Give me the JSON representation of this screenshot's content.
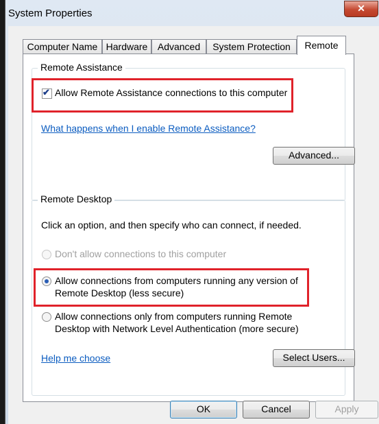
{
  "window": {
    "title": "System Properties",
    "close_glyph": "✕"
  },
  "tabs": [
    {
      "label": "Computer Name"
    },
    {
      "label": "Hardware"
    },
    {
      "label": "Advanced"
    },
    {
      "label": "System Protection"
    },
    {
      "label": "Remote"
    }
  ],
  "active_tab": "Remote",
  "remote_assistance": {
    "group_title": "Remote Assistance",
    "allow_label": "Allow Remote Assistance connections to this computer",
    "allow_checked": true,
    "help_link": "What happens when I enable Remote Assistance?",
    "advanced_button": "Advanced..."
  },
  "remote_desktop": {
    "group_title": "Remote Desktop",
    "instruction": "Click an option, and then specify who can connect, if needed.",
    "option_dont_allow": "Don't allow connections to this computer",
    "option_any_version_line1": "Allow connections from computers running any version of",
    "option_any_version_line2": "Remote Desktop (less secure)",
    "option_nla_line1": "Allow connections only from computers running Remote",
    "option_nla_line2": "Desktop with Network Level Authentication (more secure)",
    "selected_option": "any_version",
    "help_link": "Help me choose",
    "select_users_button": "Select Users..."
  },
  "footer": {
    "ok": "OK",
    "cancel": "Cancel",
    "apply": "Apply"
  },
  "colors": {
    "highlight": "#e0222a",
    "link": "#0b5cc0"
  }
}
